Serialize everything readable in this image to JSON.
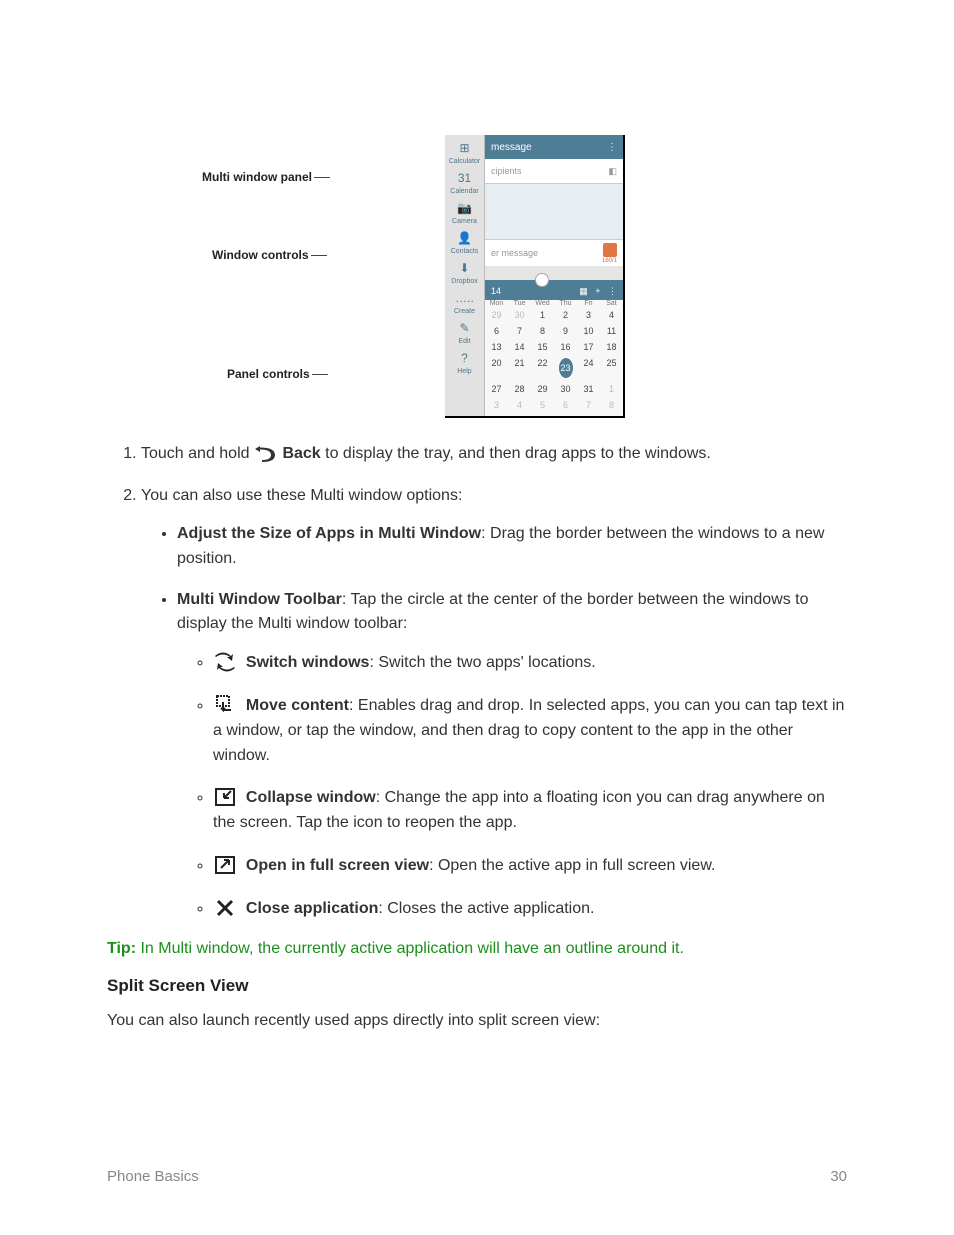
{
  "figure": {
    "labels": {
      "multiWindow": "Multi window panel",
      "windowControls": "Window controls",
      "panelControls": "Panel controls"
    },
    "panelApps": [
      {
        "icon": "⊞",
        "label": "Calculator"
      },
      {
        "icon": "31",
        "label": "Calendar"
      },
      {
        "icon": "📷",
        "label": "Camera"
      },
      {
        "icon": "👤",
        "label": "Contacts"
      },
      {
        "icon": "⬇",
        "label": "Dropbox"
      },
      {
        "icon": "…..",
        "label": "Create"
      },
      {
        "icon": "✎",
        "label": "Edit"
      },
      {
        "icon": "?",
        "label": "Help"
      }
    ],
    "msg": {
      "title": "message",
      "recipients": "cipients",
      "enter": "er message",
      "count": "160/1"
    },
    "cal": {
      "head": "14",
      "dow": [
        "Mon",
        "Tue",
        "Wed",
        "Thu",
        "Fri",
        "Sat"
      ],
      "rows": [
        [
          {
            "v": "29",
            "d": 1
          },
          {
            "v": "30",
            "d": 1
          },
          {
            "v": "1"
          },
          {
            "v": "2"
          },
          {
            "v": "3"
          },
          {
            "v": "4"
          }
        ],
        [
          {
            "v": "6"
          },
          {
            "v": "7"
          },
          {
            "v": "8"
          },
          {
            "v": "9"
          },
          {
            "v": "10"
          },
          {
            "v": "11"
          }
        ],
        [
          {
            "v": "13"
          },
          {
            "v": "14"
          },
          {
            "v": "15"
          },
          {
            "v": "16"
          },
          {
            "v": "17"
          },
          {
            "v": "18"
          }
        ],
        [
          {
            "v": "20"
          },
          {
            "v": "21"
          },
          {
            "v": "22"
          },
          {
            "v": "23",
            "t": 1
          },
          {
            "v": "24"
          },
          {
            "v": "25"
          }
        ],
        [
          {
            "v": "27"
          },
          {
            "v": "28"
          },
          {
            "v": "29"
          },
          {
            "v": "30"
          },
          {
            "v": "31"
          },
          {
            "v": "1",
            "d": 1
          }
        ],
        [
          {
            "v": "3",
            "d": 1
          },
          {
            "v": "4",
            "d": 1
          },
          {
            "v": "5",
            "d": 1
          },
          {
            "v": "6",
            "d": 1
          },
          {
            "v": "7",
            "d": 1
          },
          {
            "v": "8",
            "d": 1
          }
        ]
      ]
    }
  },
  "steps": {
    "s1a": "Touch and hold ",
    "s1b": "Back",
    "s1c": " to display the tray, and then drag apps to the windows.",
    "s2": "You can also use these Multi window options:"
  },
  "opts": {
    "adjust_b": "Adjust the Size of Apps in Multi Window",
    "adjust_t": ": Drag the border between the windows to a new position.",
    "toolbar_b": "Multi Window Toolbar",
    "toolbar_t": ": Tap the circle at the center of the border between the windows to display the Multi window toolbar:"
  },
  "sub": {
    "switch_b": "Switch windows",
    "switch_t": ": Switch the two apps' locations.",
    "move_b": "Move content",
    "move_t": ": Enables drag and drop. In selected apps, you can you can tap text in a window, or tap the window, and then drag to copy content to the app in the other window.",
    "collapse_b": "Collapse window",
    "collapse_t": ": Change the app into a floating icon you can drag anywhere on the screen. Tap the icon to reopen the app.",
    "full_b": "Open in full screen view",
    "full_t": ": Open the active app in full screen view.",
    "close_b": "Close application",
    "close_t": ": Closes the active application."
  },
  "tip": {
    "label": "Tip:",
    "text": " In Multi window, the currently active application will have an outline around it."
  },
  "section": "Split Screen View",
  "sectionText": "You can also launch recently used apps directly into split screen view:",
  "footerLeft": "Phone Basics",
  "footerRight": "30"
}
